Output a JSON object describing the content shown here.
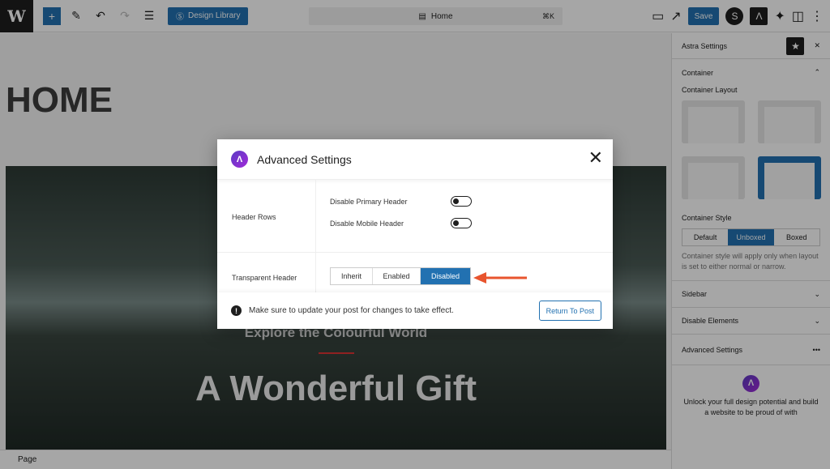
{
  "toolbar": {
    "design_library": "Design Library",
    "command_title": "Home",
    "command_shortcut": "⌘K",
    "save": "Save"
  },
  "canvas": {
    "page_title": "HOME",
    "hero_subtitle": "Explore the Colourful World",
    "hero_title": "A Wonderful Gift"
  },
  "footer": {
    "breadcrumb": "Page"
  },
  "sidebar": {
    "title": "Astra Settings",
    "container": "Container",
    "container_layout": "Container Layout",
    "container_style": "Container Style",
    "style_options": [
      "Default",
      "Unboxed",
      "Boxed"
    ],
    "selected_style": "Unboxed",
    "style_help": "Container style will apply only when layout is set to either normal or narrow.",
    "sections": [
      "Sidebar",
      "Disable Elements",
      "Advanced Settings"
    ],
    "promo": "Unlock your full design potential and build a website to be proud of with"
  },
  "modal": {
    "title": "Advanced Settings",
    "header_rows_label": "Header Rows",
    "toggles": [
      {
        "label": "Disable Primary Header",
        "on": false
      },
      {
        "label": "Disable Mobile Header",
        "on": false
      }
    ],
    "transparent_header_label": "Transparent Header",
    "transparent_options": [
      "Inherit",
      "Enabled",
      "Disabled"
    ],
    "transparent_selected": "Disabled",
    "notice": "Make sure to update your post for changes to take effect.",
    "return_button": "Return To Post"
  },
  "colors": {
    "accent": "#2271b1",
    "arrow": "#e8542e",
    "astra": "#6b2fd0"
  }
}
